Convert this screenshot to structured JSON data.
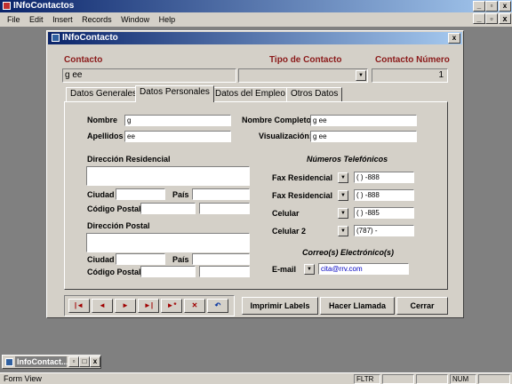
{
  "app": {
    "title": "INfoContactos",
    "status_text": "Form View",
    "status_flags": [
      "FLTR",
      "NUM"
    ],
    "taskbar_item": "InfoContact..."
  },
  "menu": [
    "File",
    "Edit",
    "Insert",
    "Records",
    "Window",
    "Help"
  ],
  "form": {
    "title": "INfoContacto",
    "header": {
      "contacto_label": "Contacto",
      "contacto_value": "g ee",
      "tipo_label": "Tipo de Contacto",
      "tipo_value": "",
      "numero_label": "Contacto Número",
      "numero_value": "1"
    },
    "tabs": [
      "Datos Generales",
      "Datos Personales",
      "Datos del Empleo",
      "Otros Datos"
    ],
    "active_tab": "Datos Personales",
    "personal": {
      "nombre_label": "Nombre",
      "nombre_value": "g",
      "apellidos_label": "Apellidos",
      "apellidos_value": "ee",
      "nombre_completo_label": "Nombre Completo:",
      "nombre_completo_value": "g ee",
      "visualizacion_label": "Visualización:",
      "visualizacion_value": "g ee",
      "dir_res_label": "Dirección Residencial",
      "ciudad_label": "Ciudad",
      "pais_label": "País",
      "codigo_postal_label": "Código Postal",
      "dir_postal_label": "Dirección Postal",
      "ciudad2_label": "Ciudad",
      "pais2_label": "País",
      "codigo_postal2_label": "Código Postal",
      "phones_heading": "Números Telefónicos",
      "phones": [
        {
          "label": "Fax Residencial",
          "value": "(   )   -888"
        },
        {
          "label": "Fax Residencial",
          "value": "(   )   -888"
        },
        {
          "label": "Celular",
          "value": "(   )   -885"
        },
        {
          "label": "Celular 2",
          "value": "(787)     -"
        }
      ],
      "email_heading": "Correo(s) Electrónico(s)",
      "email_label": "E-mail",
      "email_value": "cita@rrv.com"
    },
    "buttons": {
      "imprimir": "Imprimir Labels",
      "llamada": "Hacer Llamada",
      "cerrar": "Cerrar"
    },
    "nav_icons": [
      "first-record-icon",
      "previous-record-icon",
      "next-record-icon",
      "last-record-icon",
      "new-record-icon",
      "delete-record-icon",
      "undo-icon"
    ]
  }
}
